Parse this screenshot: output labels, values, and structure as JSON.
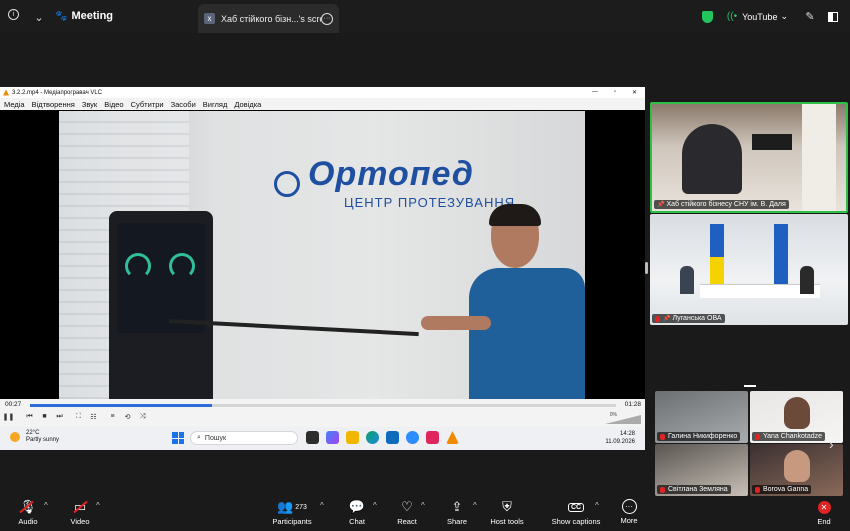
{
  "topbar": {
    "meeting_label": "Meeting",
    "tab_title": "Хаб стійкого бізн...'s screen",
    "youtube_label": "YouTube",
    "security_color": "#22c55e"
  },
  "vlc": {
    "title": "3.2.2.mp4 - Медіапрогравач VLC",
    "menu": [
      "Медіа",
      "Відтворення",
      "Звук",
      "Відео",
      "Субтитри",
      "Засоби",
      "Вигляд",
      "Довідка"
    ],
    "time_elapsed": "00:27",
    "time_total": "01:28",
    "progress": 0.31,
    "volume_label": "0%",
    "video_logo": "Ортопед",
    "video_logo_sub": "ЦЕНТР ПРОТЕЗУВАННЯ"
  },
  "taskbar": {
    "temperature": "22°C",
    "weather": "Partly sunny",
    "search_placeholder": "Пошук",
    "time": "14:28",
    "date": "11.09.2026"
  },
  "participants": [
    {
      "name": "Хаб стійкого бізнесу СНУ ім. В. Даля",
      "pinned": true
    },
    {
      "name": "Луганська ОВА",
      "pinned": true
    },
    {
      "name": "Галина Никифоренко",
      "muted": true
    },
    {
      "name": "Yana Chankotadze",
      "muted": true
    },
    {
      "name": "Світлана  Земляна",
      "muted": true
    },
    {
      "name": "Borova Ganna",
      "muted": true
    }
  ],
  "toolbar": {
    "audio": "Audio",
    "video": "Video",
    "participants": "Participants",
    "participants_count": "273",
    "chat": "Chat",
    "react": "React",
    "share": "Share",
    "host_tools": "Host tools",
    "show_captions": "Show captions",
    "captions_icon_text": "CC",
    "more": "More",
    "end": "End",
    "end_color": "#e02424"
  }
}
